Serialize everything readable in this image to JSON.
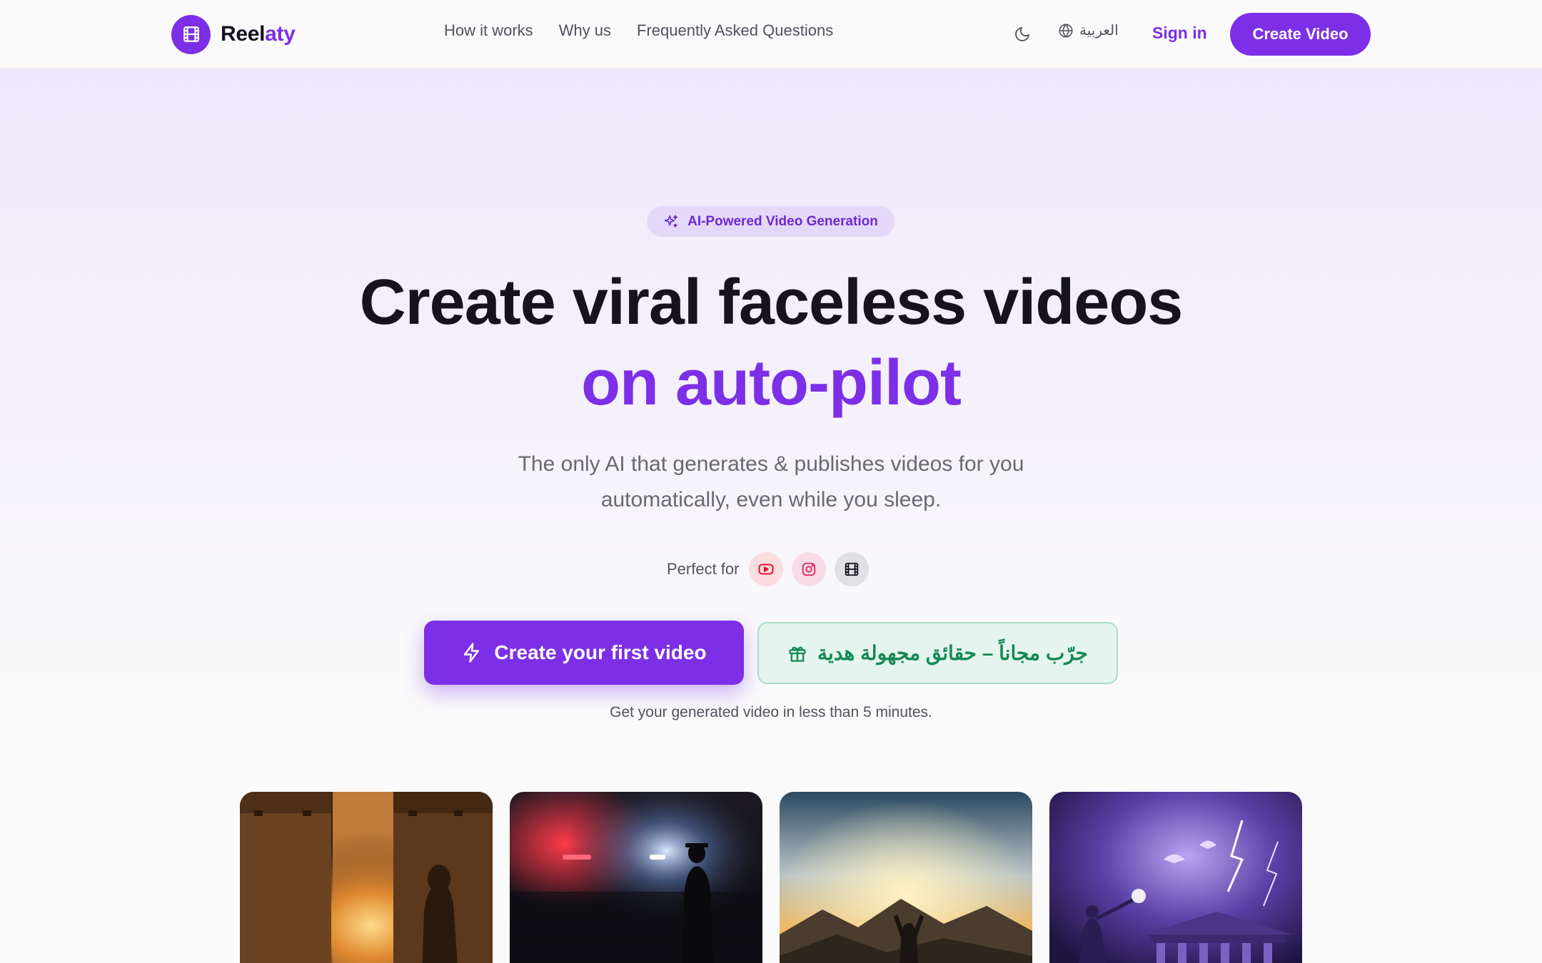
{
  "brand": {
    "name_part1": "Reel",
    "name_part2": "aty"
  },
  "nav": {
    "links": [
      "How it works",
      "Why us",
      "Frequently Asked Questions"
    ],
    "language": "العربية",
    "signin": "Sign in",
    "create": "Create Video"
  },
  "hero": {
    "badge": "AI-Powered Video Generation",
    "headline_line1": "Create viral faceless videos",
    "headline_line2": "on auto-pilot",
    "subtext_line1": "The only AI that generates & publishes videos for you",
    "subtext_line2": "automatically, even while you sleep.",
    "perfect_for": "Perfect for",
    "platforms": [
      "youtube-icon",
      "instagram-icon",
      "film-icon"
    ],
    "cta_primary": "Create your first video",
    "cta_secondary": "جرّب مجاناً – حقائق مجهولة هدية",
    "note": "Get your generated video in less than 5 minutes."
  },
  "video_cards": [
    "egyptian-temple-sunset",
    "detective-night-police-lights",
    "mountain-sunrise-rays",
    "greek-temple-lightning-storm"
  ],
  "colors": {
    "accent": "#7c2fe6",
    "green": "#138a55",
    "green_bg": "#e6f4ef",
    "text": "#16131f",
    "muted": "#52525e"
  }
}
